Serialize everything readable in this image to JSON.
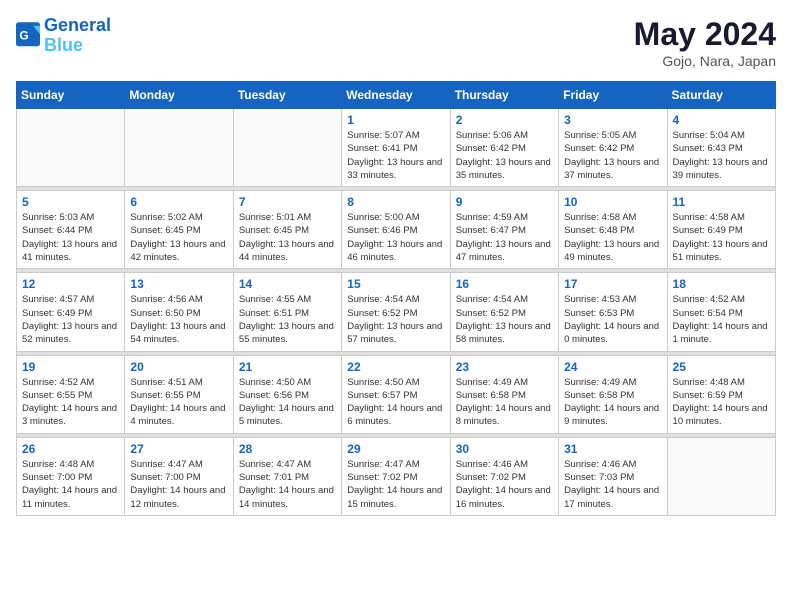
{
  "header": {
    "logo_line1": "General",
    "logo_line2": "Blue",
    "month": "May 2024",
    "location": "Gojo, Nara, Japan"
  },
  "days_of_week": [
    "Sunday",
    "Monday",
    "Tuesday",
    "Wednesday",
    "Thursday",
    "Friday",
    "Saturday"
  ],
  "weeks": [
    [
      {
        "day": "",
        "sunrise": "",
        "sunset": "",
        "daylight": ""
      },
      {
        "day": "",
        "sunrise": "",
        "sunset": "",
        "daylight": ""
      },
      {
        "day": "",
        "sunrise": "",
        "sunset": "",
        "daylight": ""
      },
      {
        "day": "1",
        "sunrise": "5:07 AM",
        "sunset": "6:41 PM",
        "daylight": "13 hours and 33 minutes."
      },
      {
        "day": "2",
        "sunrise": "5:06 AM",
        "sunset": "6:42 PM",
        "daylight": "13 hours and 35 minutes."
      },
      {
        "day": "3",
        "sunrise": "5:05 AM",
        "sunset": "6:42 PM",
        "daylight": "13 hours and 37 minutes."
      },
      {
        "day": "4",
        "sunrise": "5:04 AM",
        "sunset": "6:43 PM",
        "daylight": "13 hours and 39 minutes."
      }
    ],
    [
      {
        "day": "5",
        "sunrise": "5:03 AM",
        "sunset": "6:44 PM",
        "daylight": "13 hours and 41 minutes."
      },
      {
        "day": "6",
        "sunrise": "5:02 AM",
        "sunset": "6:45 PM",
        "daylight": "13 hours and 42 minutes."
      },
      {
        "day": "7",
        "sunrise": "5:01 AM",
        "sunset": "6:45 PM",
        "daylight": "13 hours and 44 minutes."
      },
      {
        "day": "8",
        "sunrise": "5:00 AM",
        "sunset": "6:46 PM",
        "daylight": "13 hours and 46 minutes."
      },
      {
        "day": "9",
        "sunrise": "4:59 AM",
        "sunset": "6:47 PM",
        "daylight": "13 hours and 47 minutes."
      },
      {
        "day": "10",
        "sunrise": "4:58 AM",
        "sunset": "6:48 PM",
        "daylight": "13 hours and 49 minutes."
      },
      {
        "day": "11",
        "sunrise": "4:58 AM",
        "sunset": "6:49 PM",
        "daylight": "13 hours and 51 minutes."
      }
    ],
    [
      {
        "day": "12",
        "sunrise": "4:57 AM",
        "sunset": "6:49 PM",
        "daylight": "13 hours and 52 minutes."
      },
      {
        "day": "13",
        "sunrise": "4:56 AM",
        "sunset": "6:50 PM",
        "daylight": "13 hours and 54 minutes."
      },
      {
        "day": "14",
        "sunrise": "4:55 AM",
        "sunset": "6:51 PM",
        "daylight": "13 hours and 55 minutes."
      },
      {
        "day": "15",
        "sunrise": "4:54 AM",
        "sunset": "6:52 PM",
        "daylight": "13 hours and 57 minutes."
      },
      {
        "day": "16",
        "sunrise": "4:54 AM",
        "sunset": "6:52 PM",
        "daylight": "13 hours and 58 minutes."
      },
      {
        "day": "17",
        "sunrise": "4:53 AM",
        "sunset": "6:53 PM",
        "daylight": "14 hours and 0 minutes."
      },
      {
        "day": "18",
        "sunrise": "4:52 AM",
        "sunset": "6:54 PM",
        "daylight": "14 hours and 1 minute."
      }
    ],
    [
      {
        "day": "19",
        "sunrise": "4:52 AM",
        "sunset": "6:55 PM",
        "daylight": "14 hours and 3 minutes."
      },
      {
        "day": "20",
        "sunrise": "4:51 AM",
        "sunset": "6:55 PM",
        "daylight": "14 hours and 4 minutes."
      },
      {
        "day": "21",
        "sunrise": "4:50 AM",
        "sunset": "6:56 PM",
        "daylight": "14 hours and 5 minutes."
      },
      {
        "day": "22",
        "sunrise": "4:50 AM",
        "sunset": "6:57 PM",
        "daylight": "14 hours and 6 minutes."
      },
      {
        "day": "23",
        "sunrise": "4:49 AM",
        "sunset": "6:58 PM",
        "daylight": "14 hours and 8 minutes."
      },
      {
        "day": "24",
        "sunrise": "4:49 AM",
        "sunset": "6:58 PM",
        "daylight": "14 hours and 9 minutes."
      },
      {
        "day": "25",
        "sunrise": "4:48 AM",
        "sunset": "6:59 PM",
        "daylight": "14 hours and 10 minutes."
      }
    ],
    [
      {
        "day": "26",
        "sunrise": "4:48 AM",
        "sunset": "7:00 PM",
        "daylight": "14 hours and 11 minutes."
      },
      {
        "day": "27",
        "sunrise": "4:47 AM",
        "sunset": "7:00 PM",
        "daylight": "14 hours and 12 minutes."
      },
      {
        "day": "28",
        "sunrise": "4:47 AM",
        "sunset": "7:01 PM",
        "daylight": "14 hours and 14 minutes."
      },
      {
        "day": "29",
        "sunrise": "4:47 AM",
        "sunset": "7:02 PM",
        "daylight": "14 hours and 15 minutes."
      },
      {
        "day": "30",
        "sunrise": "4:46 AM",
        "sunset": "7:02 PM",
        "daylight": "14 hours and 16 minutes."
      },
      {
        "day": "31",
        "sunrise": "4:46 AM",
        "sunset": "7:03 PM",
        "daylight": "14 hours and 17 minutes."
      },
      {
        "day": "",
        "sunrise": "",
        "sunset": "",
        "daylight": ""
      }
    ]
  ],
  "labels": {
    "sunrise_prefix": "Sunrise: ",
    "sunset_prefix": "Sunset: ",
    "daylight_prefix": "Daylight: "
  }
}
